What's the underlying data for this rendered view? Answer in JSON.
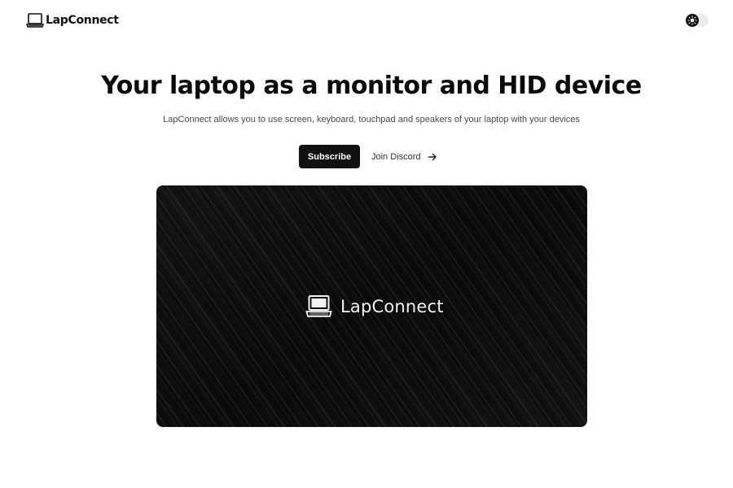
{
  "header": {
    "brand_name": "LapConnect",
    "brand_icon": "laptop-icon",
    "theme_toggle_icon": "sun-icon"
  },
  "hero": {
    "title": "Your laptop as a monitor and HID device",
    "subtitle": "LapConnect allows you to use screen, keyboard, touchpad and speakers of your laptop with your devices",
    "subscribe_label": "Subscribe",
    "discord_label": "Join Discord",
    "discord_icon": "arrow-right-icon"
  },
  "banner": {
    "logo_text": "LapConnect",
    "logo_icon": "laptop-icon"
  },
  "colors": {
    "background": "#ffffff",
    "primary": "#111111",
    "banner_bg": "#0b0b0b"
  }
}
